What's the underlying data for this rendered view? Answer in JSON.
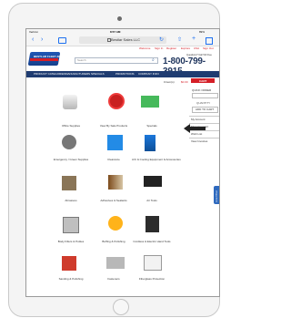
{
  "status_bar": {
    "carrier": "Verizon",
    "time": "8:57 AM",
    "battery": "89%"
  },
  "browser": {
    "url": "Bestlar Sales LLC",
    "lock_icon": "lock-icon",
    "back_icon": "chevron-left-icon",
    "forward_icon": "chevron-right-icon",
    "book_icon": "book-icon",
    "refresh_icon": "refresh-icon",
    "share_icon": "share-icon",
    "add_icon": "plus-icon",
    "tabs_icon": "tabs-icon"
  },
  "utility_nav": {
    "items": [
      "Welcome",
      "Sign In",
      "Register",
      "Explore",
      "USA",
      "Sign Out"
    ]
  },
  "header": {
    "logo_text": "BESTLAR FLEET AMERICA",
    "search_placeholder": "Search",
    "phone": "1-800-799-3915",
    "phone_note": "Questions? Call Toll Free"
  },
  "nav": {
    "items": [
      "PRODUCT CATEGORIES",
      "MANUFACTURERS",
      "SPECIALS",
      "PROMOTIONS",
      "COMPANY INFO"
    ]
  },
  "cart": {
    "label": "0 item(s)",
    "total": "$0.00",
    "button": "CART"
  },
  "sidebar": {
    "header": "QUICK ORDER",
    "qty_label": "QUANTITY",
    "button": "ADD TO CART",
    "items": [
      "My Account",
      "Shopping Cart",
      "Wish List",
      "View Invoices"
    ]
  },
  "categories": [
    {
      "label": "Office Supplies"
    },
    {
      "label": "View By Sale Products"
    },
    {
      "label": "Specials"
    },
    {
      "label": "Emergency / Green Supplies"
    },
    {
      "label": "Clearance"
    },
    {
      "label": "A/C & Cooling Equipment & Accessories"
    },
    {
      "label": "Abrasives"
    },
    {
      "label": "Adhesives & Sealants"
    },
    {
      "label": "Air Tools"
    },
    {
      "label": "Body Fillers & Putties"
    },
    {
      "label": "Buffing & Polishing"
    },
    {
      "label": "Cordless & Electric Hand Tools"
    },
    {
      "label": "Sanding & Polishing"
    },
    {
      "label": "Fasteners"
    },
    {
      "label": "Fiberglass Protection"
    }
  ],
  "live_chat": "Live Chat"
}
